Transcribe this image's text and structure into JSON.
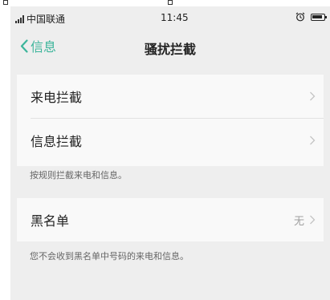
{
  "status_bar": {
    "carrier": "中国联通",
    "time": "11:45",
    "alarm_icon": "alarm-clock-icon",
    "battery_icon": "battery-icon"
  },
  "nav": {
    "back_label": "信息",
    "title": "骚扰拦截"
  },
  "sections": [
    {
      "rows": [
        {
          "label": "来电拦截",
          "value": ""
        },
        {
          "label": "信息拦截",
          "value": ""
        }
      ],
      "hint": "按规则拦截来电和信息。"
    },
    {
      "rows": [
        {
          "label": "黑名单",
          "value": "无"
        }
      ],
      "hint": "您不会收到黑名单中号码的来电和信息。"
    }
  ],
  "colors": {
    "accent": "#3cb59b",
    "background": "#eeeeee",
    "card": "#f9f9f9"
  }
}
